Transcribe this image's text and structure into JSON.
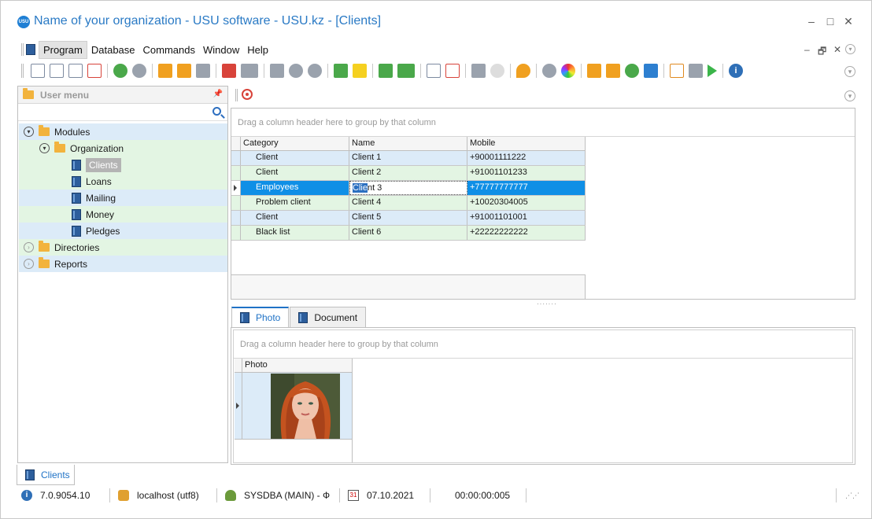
{
  "window": {
    "title": "Name of your organization - USU software - USU.kz - [Clients]",
    "logo_text": "USU"
  },
  "menu": {
    "items": [
      "Program",
      "Database",
      "Commands",
      "Window",
      "Help"
    ]
  },
  "user_menu": {
    "title": "User menu",
    "tree": {
      "modules": "Modules",
      "organization": "Organization",
      "clients": "Clients",
      "loans": "Loans",
      "mailing": "Mailing",
      "money": "Money",
      "pledges": "Pledges",
      "directories": "Directories",
      "reports": "Reports"
    }
  },
  "clients_grid": {
    "group_hint": "Drag a column header here to group by that column",
    "columns": [
      "Category",
      "Name",
      "Mobile"
    ],
    "rows": [
      {
        "category": "Client",
        "name": "Client 1",
        "mobile": "+90001111222"
      },
      {
        "category": "Client",
        "name": "Client 2",
        "mobile": "+91001101233"
      },
      {
        "category": "Employees",
        "name_sel": "Clie",
        "name_rest": "nt 3",
        "mobile": "+77777777777"
      },
      {
        "category": "Problem client",
        "name": "Client 4",
        "mobile": "+10020304005"
      },
      {
        "category": "Client",
        "name": "Client 5",
        "mobile": "+91001101001"
      },
      {
        "category": "Black list",
        "name": "Client 6",
        "mobile": "+22222222222"
      }
    ]
  },
  "detail_tabs": {
    "photo": "Photo",
    "document": "Document"
  },
  "photo_grid": {
    "group_hint": "Drag a column header here to group by that column",
    "column": "Photo"
  },
  "doc_tab": "Clients",
  "status": {
    "version": "7.0.9054.10",
    "server": "localhost (utf8)",
    "user": "SYSDBA (MAIN) - Ф",
    "calendar_icon_text": "31",
    "date": "07.10.2021",
    "timer": "00:00:00:005"
  },
  "colors": {
    "accent": "#2a7ac5",
    "row_blue": "#dcebf8",
    "row_green": "#e3f5e3",
    "row_focused": "#0f8fe6"
  }
}
